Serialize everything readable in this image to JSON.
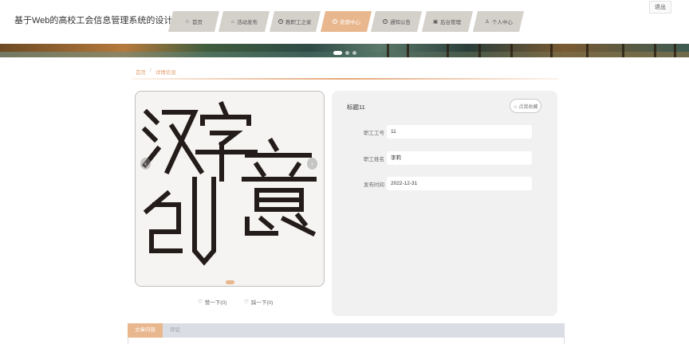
{
  "header": {
    "site_title": "基于Web的高校工会信息管理系统的设计与实现",
    "logout_label": "退出"
  },
  "nav": {
    "items": [
      {
        "label": "首页",
        "icon": "star-icon",
        "active": false
      },
      {
        "label": "活动发布",
        "icon": "home-icon",
        "active": false
      },
      {
        "label": "教职工之家",
        "icon": "info-icon",
        "active": false
      },
      {
        "label": "资源中心",
        "icon": "info-icon",
        "active": true
      },
      {
        "label": "通知公告",
        "icon": "info-icon",
        "active": false
      },
      {
        "label": "后台管理",
        "icon": "briefcase-icon",
        "active": false
      },
      {
        "label": "个人中心",
        "icon": "user-icon",
        "active": false
      }
    ]
  },
  "breadcrumb": {
    "home": "首页",
    "separator": "/",
    "current": "详情信息"
  },
  "detail": {
    "title": "标题11",
    "favorite_label": "☆ 点我收藏",
    "fields": [
      {
        "label": "职工工号",
        "value": "11"
      },
      {
        "label": "职工姓名",
        "value": "李莉"
      },
      {
        "label": "发布时间",
        "value": "2022-12-31"
      }
    ]
  },
  "actions": {
    "like_label": "赞一下(0)",
    "dislike_label": "踩一下(0)"
  },
  "tabs": [
    {
      "label": "文章内容",
      "active": true
    },
    {
      "label": "评论",
      "active": false
    }
  ],
  "colors": {
    "accent": "#e9b78e",
    "nav_inactive": "#d4d1cb",
    "panel_bg": "#f1f1f1"
  }
}
